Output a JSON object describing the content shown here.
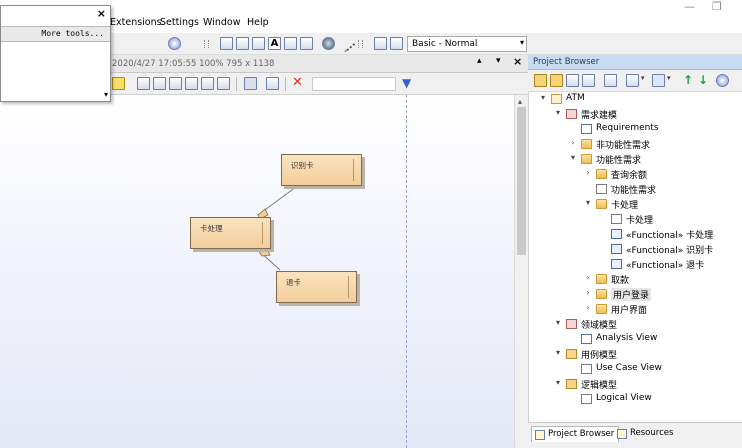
{
  "menu": {
    "items": [
      "Extensions",
      "Settings",
      "Window",
      "Help"
    ]
  },
  "window_controls": {
    "minimize": "—",
    "restore": "❐"
  },
  "toolbar": {
    "style_select": "Basic - Normal",
    "dropdown_arrow": "▾"
  },
  "toolbox": {
    "close": "×",
    "more_tools": "More tools...",
    "scroll_down": "▾"
  },
  "diagram": {
    "info": "2020/4/27 17:05:55  100%  795 x 1138",
    "scroll_up": "▴",
    "header_controls": [
      "▴",
      "▾",
      "×"
    ],
    "nodes": [
      {
        "label": "识别卡"
      },
      {
        "label": "卡处理"
      },
      {
        "label": "退卡"
      }
    ]
  },
  "project_browser": {
    "title": "Project Browser",
    "tree": [
      {
        "label": "ATM",
        "expander": "▾",
        "icon": "model"
      },
      {
        "label": "需求建模",
        "expander": "▾",
        "icon": "req"
      },
      {
        "label": "Requirements",
        "expander": "",
        "icon": "diag"
      },
      {
        "label": "非功能性需求",
        "expander": "›",
        "icon": "folder"
      },
      {
        "label": "功能性需求",
        "expander": "▾",
        "icon": "folder"
      },
      {
        "label": "查询余额",
        "expander": "›",
        "icon": "folder"
      },
      {
        "label": "功能性需求",
        "expander": "",
        "icon": "tree"
      },
      {
        "label": "卡处理",
        "expander": "▾",
        "icon": "folder"
      },
      {
        "label": "卡处理",
        "expander": "",
        "icon": "tree"
      },
      {
        "label": "«Functional» 卡处理",
        "expander": "",
        "icon": "elem"
      },
      {
        "label": "«Functional» 识别卡",
        "expander": "",
        "icon": "elem"
      },
      {
        "label": "«Functional» 退卡",
        "expander": "",
        "icon": "elem"
      },
      {
        "label": "取款",
        "expander": "›",
        "icon": "folder"
      },
      {
        "label": "用户登录",
        "expander": "›",
        "icon": "folder"
      },
      {
        "label": "用户界面",
        "expander": "›",
        "icon": "folder"
      },
      {
        "label": "领域模型",
        "expander": "▾",
        "icon": "req"
      },
      {
        "label": "Analysis View",
        "expander": "",
        "icon": "diag"
      },
      {
        "label": "用例模型",
        "expander": "▾",
        "icon": "pkg"
      },
      {
        "label": "Use Case View",
        "expander": "",
        "icon": "tree"
      },
      {
        "label": "逻辑模型",
        "expander": "▾",
        "icon": "pkg"
      },
      {
        "label": "Logical View",
        "expander": "",
        "icon": "tree"
      }
    ],
    "tabs": [
      "Project Browser",
      "Resources"
    ]
  }
}
